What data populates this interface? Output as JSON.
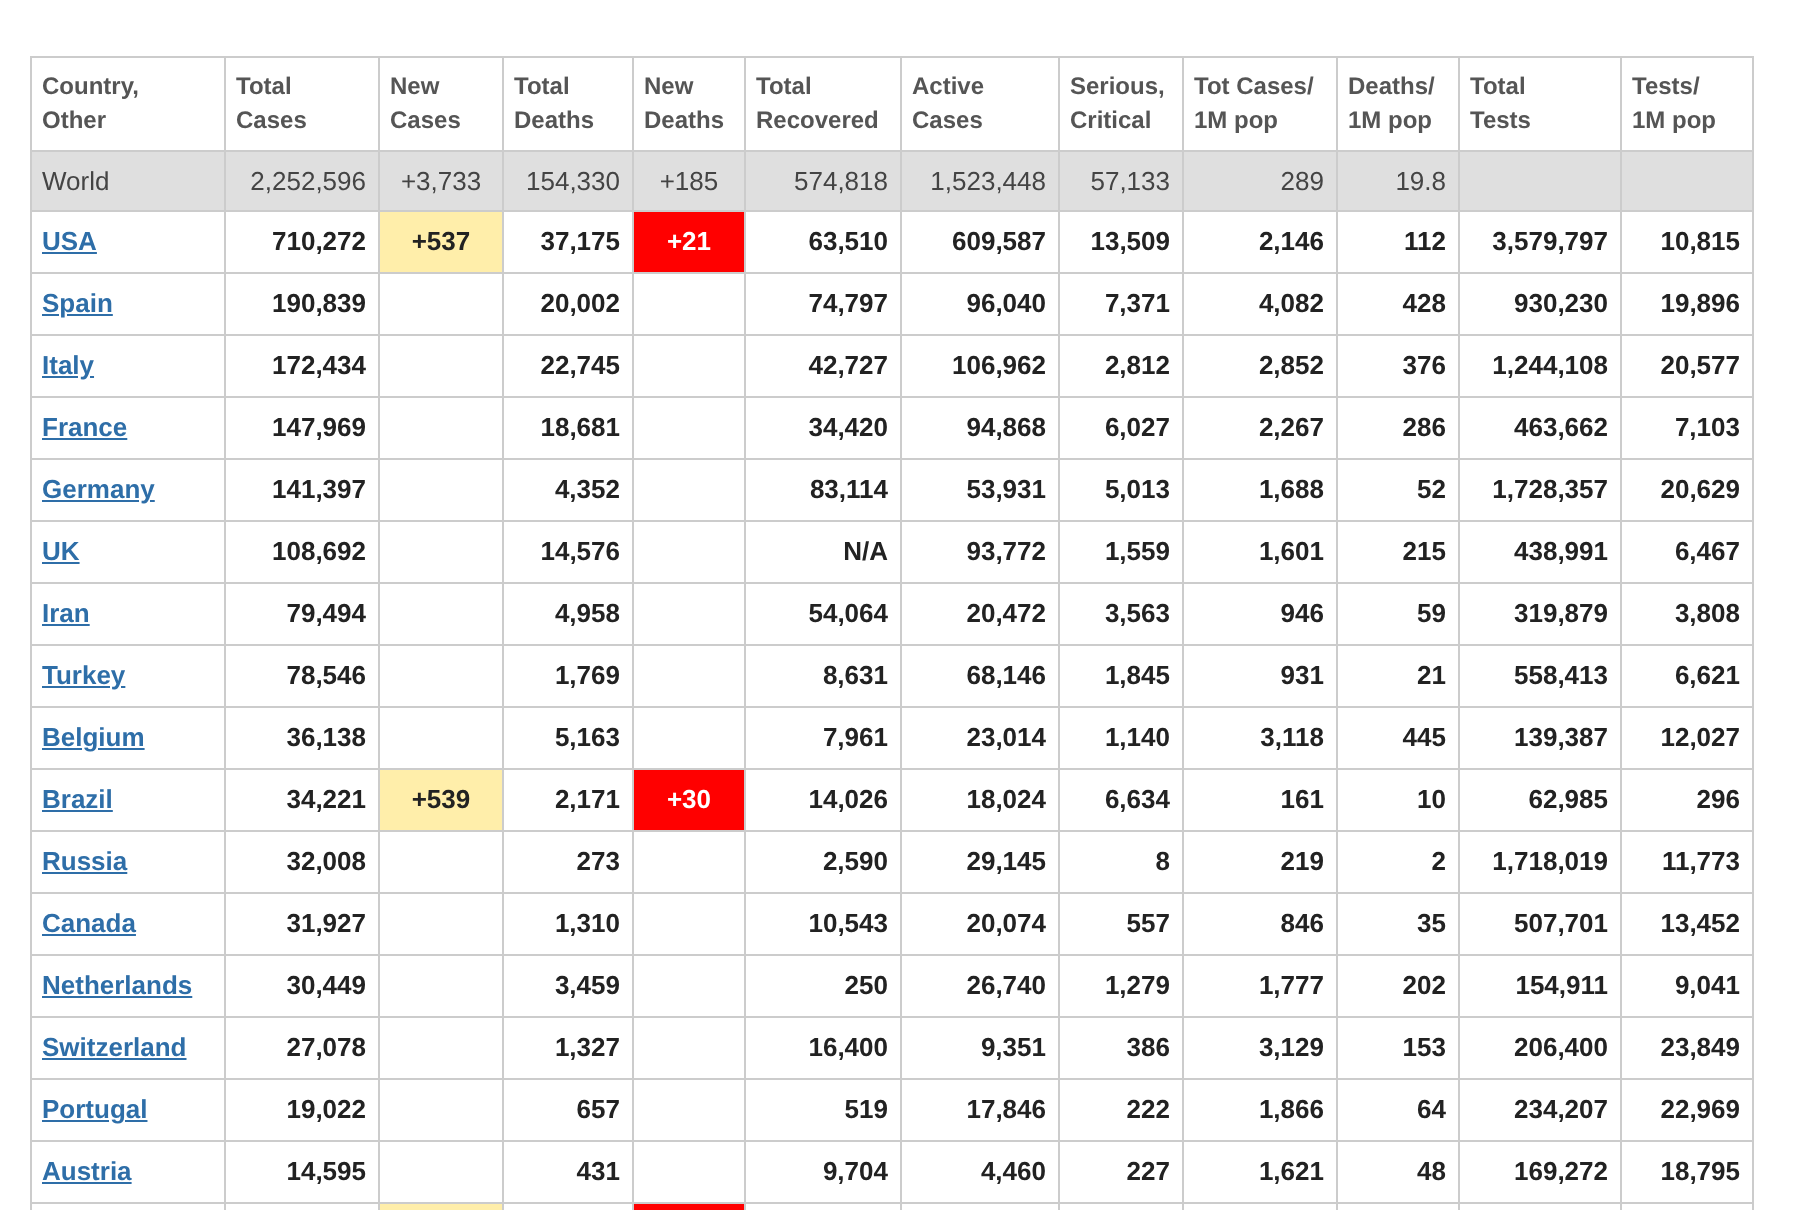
{
  "table": {
    "columns": [
      "Country,\nOther",
      "Total\nCases",
      "New\nCases",
      "Total\nDeaths",
      "New\nDeaths",
      "Total\nRecovered",
      "Active\nCases",
      "Serious,\nCritical",
      "Tot Cases/\n1M pop",
      "Deaths/\n1M pop",
      "Total\nTests",
      "Tests/\n1M pop"
    ],
    "rows": [
      {
        "kind": "world",
        "new_cases_highlighted": false,
        "new_deaths_highlighted": false,
        "cells": [
          "World",
          "2,252,596",
          "+3,733",
          "154,330",
          "+185",
          "574,818",
          "1,523,448",
          "57,133",
          "289",
          "19.8",
          null,
          null
        ]
      },
      {
        "kind": "country",
        "new_cases_highlighted": true,
        "new_deaths_highlighted": true,
        "cells": [
          "USA",
          "710,272",
          "+537",
          "37,175",
          "+21",
          "63,510",
          "609,587",
          "13,509",
          "2,146",
          "112",
          "3,579,797",
          "10,815"
        ]
      },
      {
        "kind": "country",
        "new_cases_highlighted": false,
        "new_deaths_highlighted": false,
        "cells": [
          "Spain",
          "190,839",
          null,
          "20,002",
          null,
          "74,797",
          "96,040",
          "7,371",
          "4,082",
          "428",
          "930,230",
          "19,896"
        ]
      },
      {
        "kind": "country",
        "new_cases_highlighted": false,
        "new_deaths_highlighted": false,
        "cells": [
          "Italy",
          "172,434",
          null,
          "22,745",
          null,
          "42,727",
          "106,962",
          "2,812",
          "2,852",
          "376",
          "1,244,108",
          "20,577"
        ]
      },
      {
        "kind": "country",
        "new_cases_highlighted": false,
        "new_deaths_highlighted": false,
        "cells": [
          "France",
          "147,969",
          null,
          "18,681",
          null,
          "34,420",
          "94,868",
          "6,027",
          "2,267",
          "286",
          "463,662",
          "7,103"
        ]
      },
      {
        "kind": "country",
        "new_cases_highlighted": false,
        "new_deaths_highlighted": false,
        "cells": [
          "Germany",
          "141,397",
          null,
          "4,352",
          null,
          "83,114",
          "53,931",
          "5,013",
          "1,688",
          "52",
          "1,728,357",
          "20,629"
        ]
      },
      {
        "kind": "country",
        "new_cases_highlighted": false,
        "new_deaths_highlighted": false,
        "cells": [
          "UK",
          "108,692",
          null,
          "14,576",
          null,
          "N/A",
          "93,772",
          "1,559",
          "1,601",
          "215",
          "438,991",
          "6,467"
        ]
      },
      {
        "kind": "country",
        "new_cases_highlighted": false,
        "new_deaths_highlighted": false,
        "cells": [
          "Iran",
          "79,494",
          null,
          "4,958",
          null,
          "54,064",
          "20,472",
          "3,563",
          "946",
          "59",
          "319,879",
          "3,808"
        ]
      },
      {
        "kind": "country",
        "new_cases_highlighted": false,
        "new_deaths_highlighted": false,
        "cells": [
          "Turkey",
          "78,546",
          null,
          "1,769",
          null,
          "8,631",
          "68,146",
          "1,845",
          "931",
          "21",
          "558,413",
          "6,621"
        ]
      },
      {
        "kind": "country",
        "new_cases_highlighted": false,
        "new_deaths_highlighted": false,
        "cells": [
          "Belgium",
          "36,138",
          null,
          "5,163",
          null,
          "7,961",
          "23,014",
          "1,140",
          "3,118",
          "445",
          "139,387",
          "12,027"
        ]
      },
      {
        "kind": "country",
        "new_cases_highlighted": true,
        "new_deaths_highlighted": true,
        "cells": [
          "Brazil",
          "34,221",
          "+539",
          "2,171",
          "+30",
          "14,026",
          "18,024",
          "6,634",
          "161",
          "10",
          "62,985",
          "296"
        ]
      },
      {
        "kind": "country",
        "new_cases_highlighted": false,
        "new_deaths_highlighted": false,
        "cells": [
          "Russia",
          "32,008",
          null,
          "273",
          null,
          "2,590",
          "29,145",
          "8",
          "219",
          "2",
          "1,718,019",
          "11,773"
        ]
      },
      {
        "kind": "country",
        "new_cases_highlighted": false,
        "new_deaths_highlighted": false,
        "cells": [
          "Canada",
          "31,927",
          null,
          "1,310",
          null,
          "10,543",
          "20,074",
          "557",
          "846",
          "35",
          "507,701",
          "13,452"
        ]
      },
      {
        "kind": "country",
        "new_cases_highlighted": false,
        "new_deaths_highlighted": false,
        "cells": [
          "Netherlands",
          "30,449",
          null,
          "3,459",
          null,
          "250",
          "26,740",
          "1,279",
          "1,777",
          "202",
          "154,911",
          "9,041"
        ]
      },
      {
        "kind": "country",
        "new_cases_highlighted": false,
        "new_deaths_highlighted": false,
        "cells": [
          "Switzerland",
          "27,078",
          null,
          "1,327",
          null,
          "16,400",
          "9,351",
          "386",
          "3,129",
          "153",
          "206,400",
          "23,849"
        ]
      },
      {
        "kind": "country",
        "new_cases_highlighted": false,
        "new_deaths_highlighted": false,
        "cells": [
          "Portugal",
          "19,022",
          null,
          "657",
          null,
          "519",
          "17,846",
          "222",
          "1,866",
          "64",
          "234,207",
          "22,969"
        ]
      },
      {
        "kind": "country",
        "new_cases_highlighted": false,
        "new_deaths_highlighted": false,
        "cells": [
          "Austria",
          "14,595",
          null,
          "431",
          null,
          "9,704",
          "4,460",
          "227",
          "1,621",
          "48",
          "169,272",
          "18,795"
        ]
      },
      {
        "kind": "country",
        "new_cases_highlighted": true,
        "new_deaths_highlighted": true,
        "cells": [
          null,
          null,
          null,
          null,
          null,
          null,
          null,
          null,
          null,
          null,
          null,
          null
        ]
      }
    ]
  }
}
